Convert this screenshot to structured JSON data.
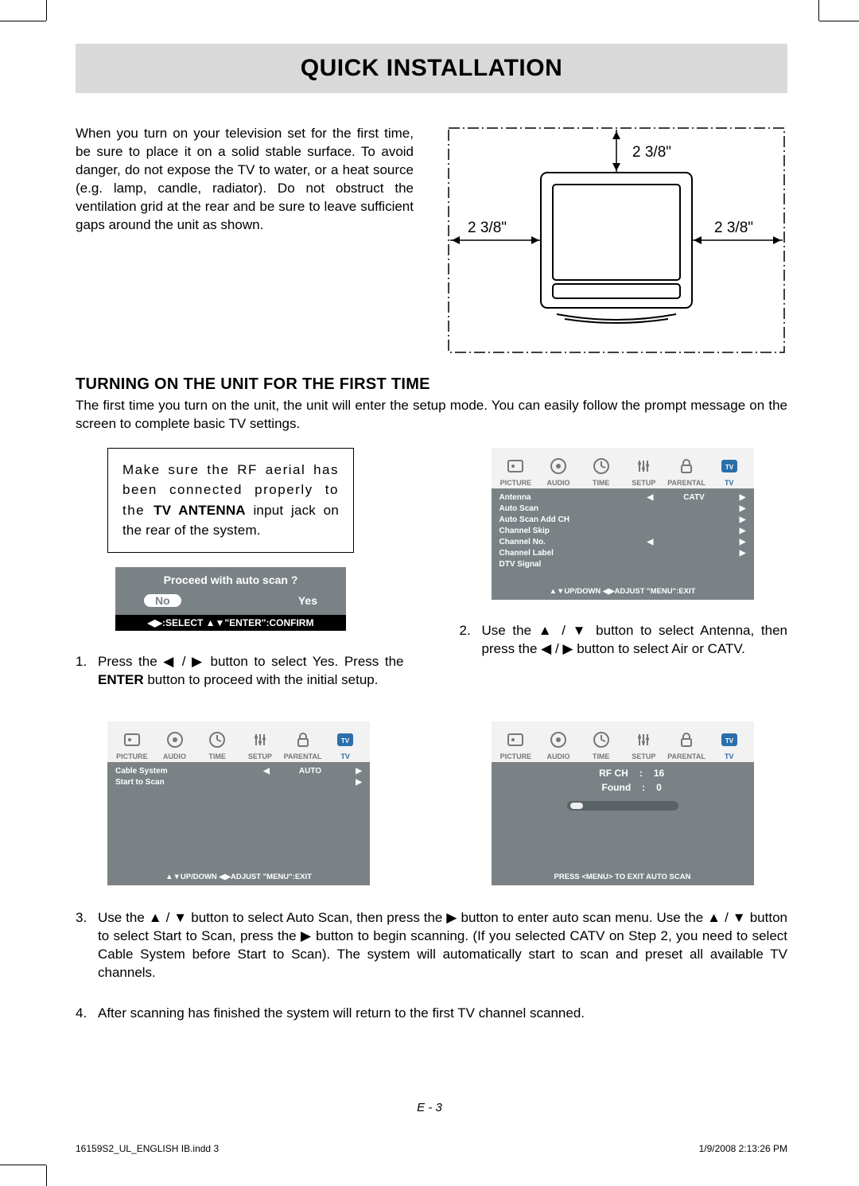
{
  "title": "QUICK INSTALLATION",
  "intro": "When you turn on your television set for the first time, be sure to place it on a solid stable surface. To avoid danger, do not expose the TV to water, or a heat source (e.g. lamp, candle, radiator). Do not obstruct the ventilation grid at the rear and be sure to leave sufficient gaps around the unit as shown.",
  "diagram": {
    "gap_top": "2  3/8\"",
    "gap_left": "2  3/8\"",
    "gap_right": "2  3/8\""
  },
  "section_heading": "TURNING ON THE UNIT FOR THE FIRST TIME",
  "section_text": "The first time you turn on the unit, the unit will enter the setup mode. You can easily follow the prompt message on the screen to complete basic TV settings.",
  "rf_note_prefix": "Make sure the RF aerial has been connected properly to the ",
  "rf_note_bold": "TV ANTENNA",
  "rf_note_suffix": " input jack on the rear of the system.",
  "dialog": {
    "question": "Proceed with auto scan ?",
    "no": "No",
    "yes": "Yes",
    "footer": "◀▶:SELECT   ▲▼\"ENTER\":CONFIRM"
  },
  "step1_a": "Press the ",
  "step1_b": " button to select Yes. Press the ",
  "step1_bold": "ENTER",
  "step1_c": " button to proceed with the initial setup.",
  "step2_a": "Use the ",
  "step2_b": " button to select Antenna, then press the ",
  "step2_c": " button to select Air or CATV.",
  "arrows": {
    "lr": "◀ / ▶",
    "ud": "▲ / ▼",
    "r": "▶"
  },
  "osd_tabs": [
    "PICTURE",
    "AUDIO",
    "TIME",
    "SETUP",
    "PARENTAL",
    "TV"
  ],
  "osd_tv_items": [
    {
      "label": "Antenna",
      "left": "◀",
      "value": "CATV",
      "right": "▶"
    },
    {
      "label": "Auto Scan",
      "left": "",
      "value": "",
      "right": "▶"
    },
    {
      "label": "Auto Scan Add CH",
      "left": "",
      "value": "",
      "right": "▶"
    },
    {
      "label": "Channel Skip",
      "left": "",
      "value": "",
      "right": "▶"
    },
    {
      "label": "Channel No.",
      "left": "◀",
      "value": "",
      "right": "▶"
    },
    {
      "label": "Channel Label",
      "left": "",
      "value": "",
      "right": "▶"
    },
    {
      "label": "DTV Signal",
      "left": "",
      "value": "",
      "right": ""
    }
  ],
  "osd_tv_footer": "▲▼UP/DOWN  ◀▶ADJUST  \"MENU\":EXIT",
  "osd_autoscan_items": [
    {
      "label": "Cable System",
      "left": "◀",
      "value": "AUTO",
      "right": "▶"
    },
    {
      "label": "Start to Scan",
      "left": "",
      "value": "",
      "right": "▶"
    }
  ],
  "osd_autoscan_footer": "▲▼UP/DOWN  ◀▶ADJUST  \"MENU\":EXIT",
  "osd_scanning": {
    "rf_ch_label": "RF CH",
    "rf_ch_value": "16",
    "found_label": "Found",
    "found_value": "0",
    "footer": "PRESS <MENU> TO EXIT AUTO SCAN"
  },
  "step3": "Use the ▲ / ▼ button to select Auto Scan, then press the ▶ button to enter auto scan menu. Use the ▲ / ▼ button to select Start to Scan, press the ▶ button to begin scanning. (If you selected CATV on Step 2, you need to select Cable System before Start to Scan). The system will automatically start to scan and preset all available TV channels.",
  "step4": "After scanning has finished the system will return to the first TV channel scanned.",
  "page_number": "E - 3",
  "footer_file": "16159S2_UL_ENGLISH IB.indd   3",
  "footer_date": "1/9/2008   2:13:26 PM"
}
